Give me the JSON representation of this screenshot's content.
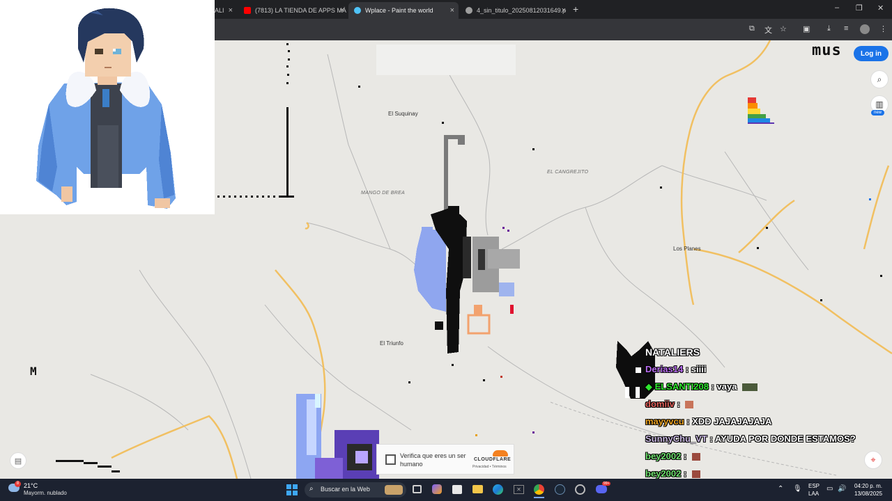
{
  "browser": {
    "tabs": [
      {
        "label": "ALI",
        "active": false,
        "favicon_color": "#9e9e9e"
      },
      {
        "label": "(7813) LA TIENDA DE APPS MÁ",
        "active": false,
        "favicon_color": "#ff0000"
      },
      {
        "label": "Wplace - Paint the world",
        "active": true,
        "favicon_color": "#4fc3f7"
      },
      {
        "label": "4_sin_titulo_20250812031649.p",
        "active": false,
        "favicon_color": "#9e9e9e"
      }
    ],
    "new_tab_symbol": "+",
    "close_symbol": "×",
    "window_controls": [
      "–",
      "❐",
      "✕"
    ]
  },
  "toolbar_icons": [
    "install-icon",
    "translate-icon",
    "star-icon",
    "extensions-icon",
    "download-icon",
    "media-icon",
    "profile-icon",
    "menu-icon"
  ],
  "map": {
    "places": [
      {
        "name": "El Suquinay",
        "style": "normal"
      },
      {
        "name": "EL CANGREJITO",
        "style": "italic"
      },
      {
        "name": "MANGO DE BREA",
        "style": "italic"
      },
      {
        "name": "Los Planes",
        "style": "normal"
      },
      {
        "name": "El Triunfo",
        "style": "normal"
      }
    ],
    "pixel_text_top_right": "mus",
    "pixel_text_left": "M",
    "login_label": "Log in",
    "new_badge": "new",
    "colors": {
      "background": "#e9e8e4",
      "road": "#f3c56a",
      "trail": "#b0b0b0",
      "accent": "#1a73e8"
    }
  },
  "captcha": {
    "label": "Verifica que eres un ser humano",
    "brand": "CLOUDFLARE",
    "links": "Privacidad • Términos"
  },
  "chat": {
    "header": "NATALIERS",
    "messages": [
      {
        "user": "Derias14",
        "user_color": "#b86cf0",
        "text": "siiii",
        "emote": ""
      },
      {
        "user": "ELSANTI208",
        "user_color": "#2ee62e",
        "text": "vaya",
        "emote": "wide",
        "badge": "◆"
      },
      {
        "user": "domiiv",
        "user_color": "#e0605a",
        "text": "",
        "emote": "small"
      },
      {
        "user": "mayyvcu",
        "user_color": "#e8a020",
        "text": "XDD JAJAJAJAJA",
        "emote": ""
      },
      {
        "user": "SunnyChu_VT",
        "user_color": "#c8b7e0",
        "text": "AYUDA POR DONDE ESTAMOS?",
        "emote": ""
      },
      {
        "user": "bey2002",
        "user_color": "#6ee06e",
        "text": "",
        "emote": "small"
      },
      {
        "user": "bey2002",
        "user_color": "#6ee06e",
        "text": "",
        "emote": "small"
      }
    ],
    "separator": " : "
  },
  "taskbar": {
    "weather_temp": "21°C",
    "weather_desc": "Mayorm. nublado",
    "notification_count": "8",
    "search_placeholder": "Buscar en la Web",
    "lang_top": "ESP",
    "lang_bottom": "LAA",
    "time": "04:20 p. m.",
    "date": "13/08/2025",
    "discord_badge": "99+"
  }
}
